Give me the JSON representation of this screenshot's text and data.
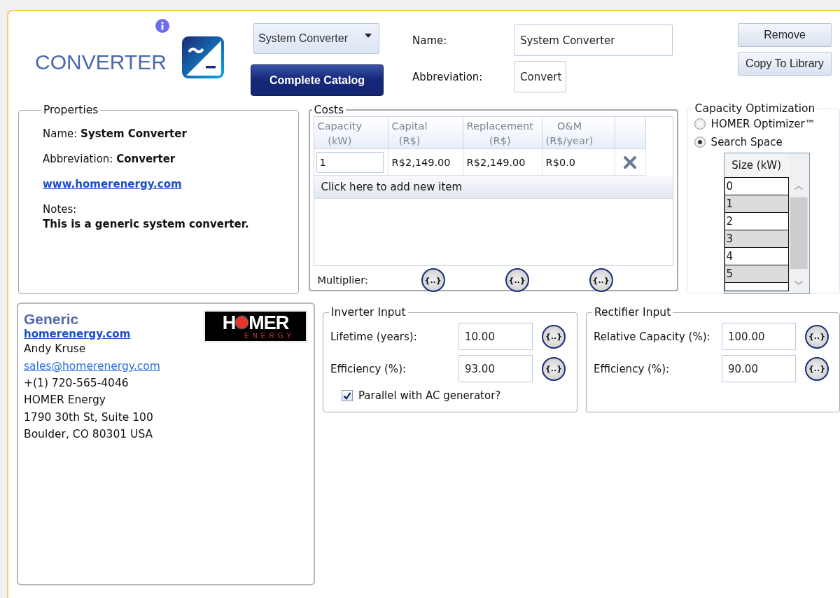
{
  "header": {
    "title": "CONVERTER",
    "component_dropdown": "System Converter",
    "catalog_button": "Complete Catalog",
    "name_label": "Name:",
    "name_value": "System Converter",
    "abbreviation_label": "Abbreviation:",
    "abbreviation_value": "Convert",
    "buttons": [
      "Remove",
      "Copy To Library"
    ]
  },
  "properties": {
    "legend": "Properties",
    "name_label": "Name:",
    "name_value": "System Converter",
    "abbreviation_label": "Abbreviation:",
    "abbreviation_value": "Converter",
    "link": "www.homerenergy.com",
    "notes_label": "Notes:",
    "notes": "This is a generic system converter."
  },
  "costs": {
    "legend": "Costs",
    "columns": [
      "Capacity\n(kW)",
      "Capital\n(R$)",
      "Replacement\n(R$)",
      "O&M\n(R$/year)"
    ],
    "rows": [
      {
        "capacity": "1",
        "capital": "R$2,149.00",
        "replacement": "R$2,149.00",
        "om": "R$0.0"
      }
    ],
    "add_row": "Click here to add new item",
    "multiplier_label": "Multiplier:",
    "multiplier_buttons": [
      "{..}",
      "{..}",
      "{..}"
    ]
  },
  "capacity_optimization": {
    "legend": "Capacity Optimization",
    "options": [
      {
        "label": "HOMER Optimizer™",
        "selected": false
      },
      {
        "label": "Search Space",
        "selected": true
      }
    ],
    "size_header": "Size (kW)",
    "sizes": [
      "0",
      "1",
      "2",
      "3",
      "4",
      "5"
    ]
  },
  "vendor": {
    "name": "Generic",
    "website": "homerenergy.com",
    "contact": "Andy Kruse",
    "email": "sales@homerenergy.com",
    "lines": [
      "+(1) 720-565-4046",
      "HOMER Energy",
      "1790 30th St, Suite 100",
      "Boulder, CO 80301 USA"
    ],
    "logo": {
      "left": "H",
      "right": "MER",
      "subtitle": "ENERGY"
    }
  },
  "inverter": {
    "legend": "Inverter Input",
    "fields": [
      {
        "label": "Lifetime (years):",
        "value": "10.00",
        "button": "{..}"
      },
      {
        "label": "Efficiency (%):",
        "value": "93.00",
        "button": "{..}"
      }
    ],
    "parallel": {
      "label": "Parallel with AC generator?",
      "checked": true
    }
  },
  "rectifier": {
    "legend": "Rectifier Input",
    "fields": [
      {
        "label": "Relative Capacity (%):",
        "value": "100.00",
        "button": "{..}"
      },
      {
        "label": "Efficiency (%):",
        "value": "90.00",
        "button": "{..}"
      }
    ]
  }
}
